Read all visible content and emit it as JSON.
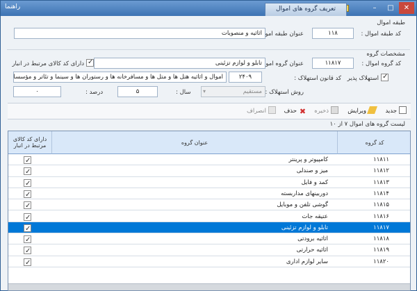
{
  "window": {
    "title": "تعریف گروه های اموال",
    "help": "راهنما"
  },
  "class_section": {
    "legend": "طبقه اموال",
    "code_label": "کد طبقه اموال :",
    "code_value": "۱۱۸",
    "title_label": "عنوان طبقه اموال :",
    "title_value": "اثاثیه و منصوبات"
  },
  "group_section": {
    "legend": "مشخصات گروه",
    "code_label": "کد گروه اموال :",
    "code_value": "۱۱۸۱۷",
    "title_label": "عنوان گروه اموال :",
    "title_value": "تابلو و لوازم تزئینی",
    "stock_checkbox_label": "دارای کد کالای مرتبط در انبار",
    "depreciable_label": "استهلاک پذیر",
    "law_code_label": "کد قانون استهلاک :",
    "law_code_value": "۲۴۰۹",
    "law_description": "اموال و اثاثیه هتل ها و متل ها و مسافرخانه ها و رستوران ها و سینما و تئاتر و مؤسسات ت",
    "method_label": "روش استهلاک :",
    "method_value": "مستقیم",
    "year_label": "سال :",
    "year_value": "۵",
    "percent_label": "درصد :",
    "percent_value": "۰"
  },
  "toolbar": {
    "new_label": "جدید",
    "edit_label": "ویرایش",
    "save_label": "ذخیره",
    "delete_label": "حذف",
    "cancel_label": "انصراف"
  },
  "list": {
    "legend": "لیست گروه های اموال ۷ از ۱۰",
    "headers": [
      "کد گروه",
      "عنوان گروه",
      "دارای کد کالای مرتبط در انبار"
    ],
    "rows": [
      {
        "code": "۱۱۸۱۱",
        "title": "کامپیوتر و پرینتر"
      },
      {
        "code": "۱۱۸۱۲",
        "title": "میز و صندلی"
      },
      {
        "code": "۱۱۸۱۳",
        "title": "کمد و فایل"
      },
      {
        "code": "۱۱۸۱۴",
        "title": "دوربینهای مداربسته"
      },
      {
        "code": "۱۱۸۱۵",
        "title": "گوشی تلفن و موبایل"
      },
      {
        "code": "۱۱۸۱۶",
        "title": "عتیقه جات"
      },
      {
        "code": "۱۱۸۱۷",
        "title": "تابلو و لوازم تزئینی"
      },
      {
        "code": "۱۱۸۱۸",
        "title": "اثاثیه برودتی"
      },
      {
        "code": "۱۱۸۱۹",
        "title": "اثاثیه حرارتی"
      },
      {
        "code": "۱۱۸۲۰",
        "title": "سایر لوازم اداری"
      }
    ]
  }
}
